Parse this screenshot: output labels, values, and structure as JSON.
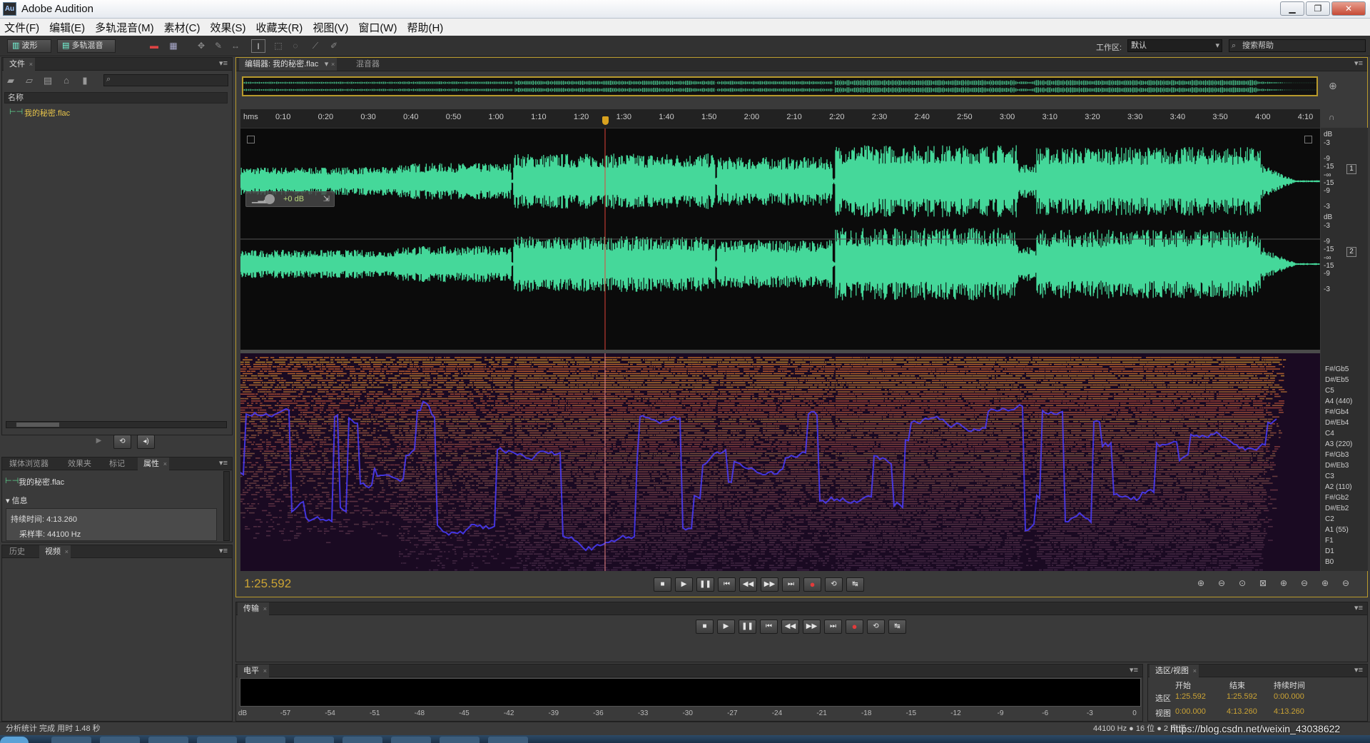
{
  "window": {
    "title": "Adobe Audition",
    "logo": "Au",
    "minimize": "▁",
    "restore": "❐",
    "close": "✕"
  },
  "menu": [
    "文件(F)",
    "编辑(E)",
    "多轨混音(M)",
    "素材(C)",
    "效果(S)",
    "收藏夹(R)",
    "视图(V)",
    "窗口(W)",
    "帮助(H)"
  ],
  "toolbar": {
    "waveform_btn": "波形",
    "multitrack_btn": "多轨混音",
    "workspace_label": "工作区:",
    "workspace_value": "默认",
    "help_placeholder": "搜索帮助"
  },
  "files_panel": {
    "tab": "文件",
    "column_header": "名称",
    "file_name": "我的秘密.flac"
  },
  "props_panel": {
    "tabs": [
      "媒体浏览器",
      "效果夹",
      "标记",
      "属性"
    ],
    "file_name": "我的秘密.flac",
    "info_header": "信息",
    "duration": "持续时间: 4:13.260",
    "sample_rate": "采样率: 44100 Hz"
  },
  "history_panel": {
    "tabs": [
      "历史",
      "视频"
    ]
  },
  "editor": {
    "tab_label": "编辑器: 我的秘密.flac",
    "mixer_tab": "混音器",
    "timeline_ticks": [
      "hms",
      "0:10",
      "0:20",
      "0:30",
      "0:40",
      "0:50",
      "1:00",
      "1:10",
      "1:20",
      "1:30",
      "1:40",
      "1:50",
      "2:00",
      "2:10",
      "2:20",
      "2:30",
      "2:40",
      "2:50",
      "3:00",
      "3:10",
      "3:20",
      "3:30",
      "3:40",
      "3:50",
      "4:00",
      "4:10"
    ],
    "hud_gain": "+0 dB",
    "current_time": "1:25.592",
    "playhead_seconds": 85.592,
    "total_seconds": 253.26,
    "db_scale": [
      "dB",
      "-3",
      "-9",
      "-15",
      "-∞",
      "-15",
      "-9",
      "-3"
    ],
    "channel_labels": [
      "1",
      "2"
    ],
    "note_scale": [
      "F#/Gb5",
      "D#/Eb5",
      "C5",
      "A4 (440)",
      "F#/Gb4",
      "D#/Eb4",
      "C4",
      "A3 (220)",
      "F#/Gb3",
      "D#/Eb3",
      "C3",
      "A2 (110)",
      "F#/Gb2",
      "D#/Eb2",
      "C2",
      "A1 (55)",
      "F1",
      "D1",
      "B0"
    ]
  },
  "transport_panel": {
    "tab": "传输"
  },
  "level_panel": {
    "tab": "电平",
    "scale": [
      "dB",
      "-57",
      "-54",
      "-51",
      "-48",
      "-45",
      "-42",
      "-39",
      "-36",
      "-33",
      "-30",
      "-27",
      "-24",
      "-21",
      "-18",
      "-15",
      "-12",
      "-9",
      "-6",
      "-3",
      "0"
    ]
  },
  "selection_panel": {
    "tab": "选区/视图",
    "headers": [
      "开始",
      "结束",
      "持续时间"
    ],
    "rows": [
      {
        "label": "选区",
        "start": "1:25.592",
        "end": "1:25.592",
        "duration": "0:00.000"
      },
      {
        "label": "视图",
        "start": "0:00.000",
        "end": "4:13.260",
        "duration": "4:13.260"
      }
    ]
  },
  "status": {
    "left": "分析统计 完成 用时 1.48 秒",
    "right": "44100 Hz ● 16 位 ● 2 声道",
    "watermark": "https://blog.csdn.net/weixin_43038622"
  },
  "colors": {
    "wave": "#45d89a",
    "accent": "#cba334",
    "playhead": "#e0443a",
    "pitch": "#4a3cff"
  }
}
